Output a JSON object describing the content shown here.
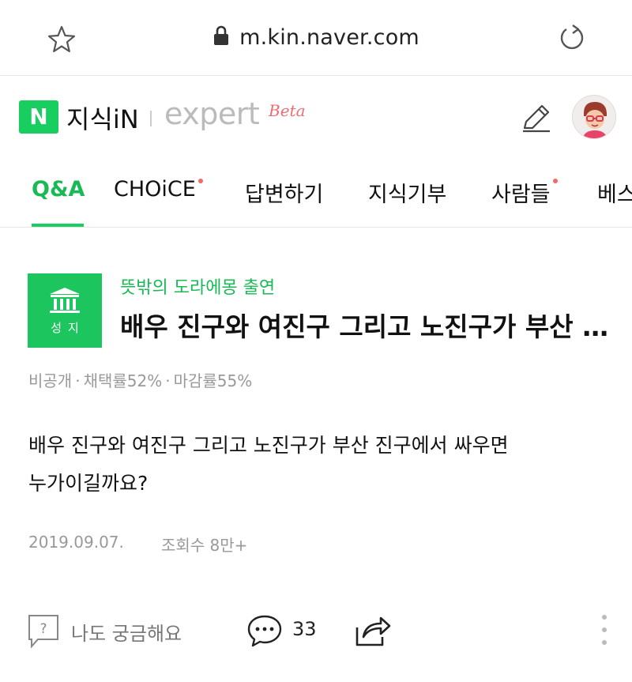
{
  "browser": {
    "url": "m.kin.naver.com",
    "icons": [
      "star-icon",
      "lock-icon",
      "reload-icon"
    ]
  },
  "header": {
    "logo_letter": "N",
    "brand": "지식iN",
    "expert": "expert",
    "beta": "Beta",
    "icons": [
      "pen-icon",
      "avatar"
    ]
  },
  "tabs": [
    {
      "label": "Q&A",
      "active": true,
      "dot": false
    },
    {
      "label": "CHOiCE",
      "active": false,
      "dot": true
    },
    {
      "label": "답변하기",
      "active": false,
      "dot": false
    },
    {
      "label": "지식기부",
      "active": false,
      "dot": false
    },
    {
      "label": "사람들",
      "active": false,
      "dot": true
    },
    {
      "label": "베스",
      "active": false,
      "dot": false
    }
  ],
  "question": {
    "badge_label": "성지",
    "category": "뜻밖의 도라에몽 출연",
    "title": "배우 진구와 여진구 그리고 노진구가 부산 진구에서 싸우면 누가이길까요?",
    "meta": {
      "visibility": "비공개",
      "adoption_rate": "채택률52%",
      "close_rate": "마감률55%"
    },
    "body_line1": "배우 진구와 여진구 그리고 노진구가 부산 진구에서 싸우면",
    "body_line2": "누가이길까요?",
    "date": "2019.09.07.",
    "views": "조회수 8만+"
  },
  "actions": {
    "curious_label": "나도 궁금해요",
    "comment_count": "33",
    "icons": [
      "question-icon",
      "comment-icon",
      "share-icon",
      "more-icon"
    ]
  },
  "colors": {
    "naver_green": "#19ce60",
    "tab_active": "#19b955",
    "notification_dot": "#f06a6a",
    "beta": "#ef6b74"
  }
}
